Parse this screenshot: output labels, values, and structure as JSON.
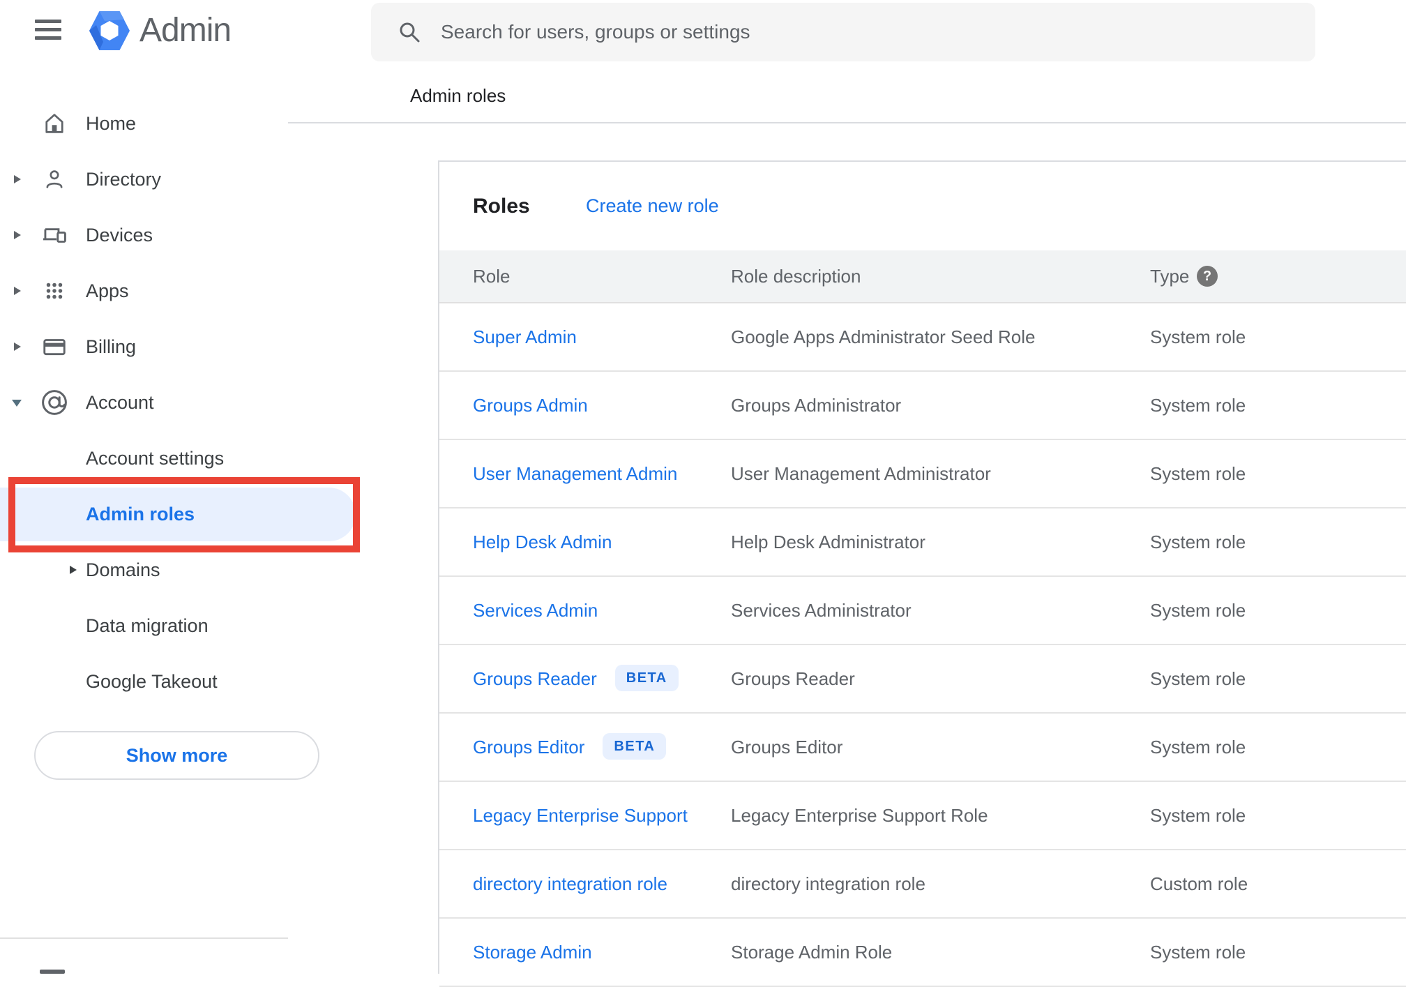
{
  "app": {
    "name": "Admin",
    "breadcrumb": "Admin roles"
  },
  "search": {
    "placeholder": "Search for users, groups or settings"
  },
  "sidebar": {
    "items": [
      {
        "label": "Home",
        "icon": "home",
        "arrow": "none",
        "level": "top"
      },
      {
        "label": "Directory",
        "icon": "person",
        "arrow": "right",
        "level": "top"
      },
      {
        "label": "Devices",
        "icon": "devices",
        "arrow": "right",
        "level": "top"
      },
      {
        "label": "Apps",
        "icon": "apps",
        "arrow": "right",
        "level": "top"
      },
      {
        "label": "Billing",
        "icon": "card",
        "arrow": "right",
        "level": "top"
      },
      {
        "label": "Account",
        "icon": "at",
        "arrow": "down",
        "level": "top"
      },
      {
        "label": "Account settings",
        "icon": "none",
        "arrow": "none",
        "level": "sub"
      },
      {
        "label": "Admin roles",
        "icon": "none",
        "arrow": "none",
        "level": "sub",
        "active": true,
        "annotated": true
      },
      {
        "label": "Domains",
        "icon": "none",
        "arrow": "sub",
        "level": "sub"
      },
      {
        "label": "Data migration",
        "icon": "none",
        "arrow": "none",
        "level": "sub"
      },
      {
        "label": "Google Takeout",
        "icon": "none",
        "arrow": "none",
        "level": "sub"
      }
    ],
    "show_more_label": "Show more"
  },
  "panel": {
    "title": "Roles",
    "create_link": "Create new role",
    "columns": [
      "Role",
      "Role description",
      "Type"
    ],
    "help_icon_glyph": "?",
    "rows": [
      {
        "role": "Super Admin",
        "beta": false,
        "description": "Google Apps Administrator Seed Role",
        "type": "System role"
      },
      {
        "role": "Groups Admin",
        "beta": false,
        "description": "Groups Administrator",
        "type": "System role"
      },
      {
        "role": "User Management Admin",
        "beta": false,
        "description": "User Management Administrator",
        "type": "System role"
      },
      {
        "role": "Help Desk Admin",
        "beta": false,
        "description": "Help Desk Administrator",
        "type": "System role"
      },
      {
        "role": "Services Admin",
        "beta": false,
        "description": "Services Administrator",
        "type": "System role"
      },
      {
        "role": "Groups Reader",
        "beta": true,
        "beta_label": "BETA",
        "description": "Groups Reader",
        "type": "System role"
      },
      {
        "role": "Groups Editor",
        "beta": true,
        "beta_label": "BETA",
        "description": "Groups Editor",
        "type": "System role"
      },
      {
        "role": "Legacy Enterprise Support",
        "beta": false,
        "description": "Legacy Enterprise Support Role",
        "type": "System role"
      },
      {
        "role": "directory integration role",
        "beta": false,
        "description": "directory integration role",
        "type": "Custom role"
      },
      {
        "role": "Storage Admin",
        "beta": false,
        "description": "Storage Admin Role",
        "type": "System role"
      }
    ]
  },
  "colors": {
    "link_blue": "#1a73e8",
    "active_item_bg": "#e8f0fe",
    "annotation_red": "#ea4335",
    "table_header_bg": "#f1f3f4",
    "secondary_text": "#5f6368",
    "beta_text": "#1967d2"
  }
}
